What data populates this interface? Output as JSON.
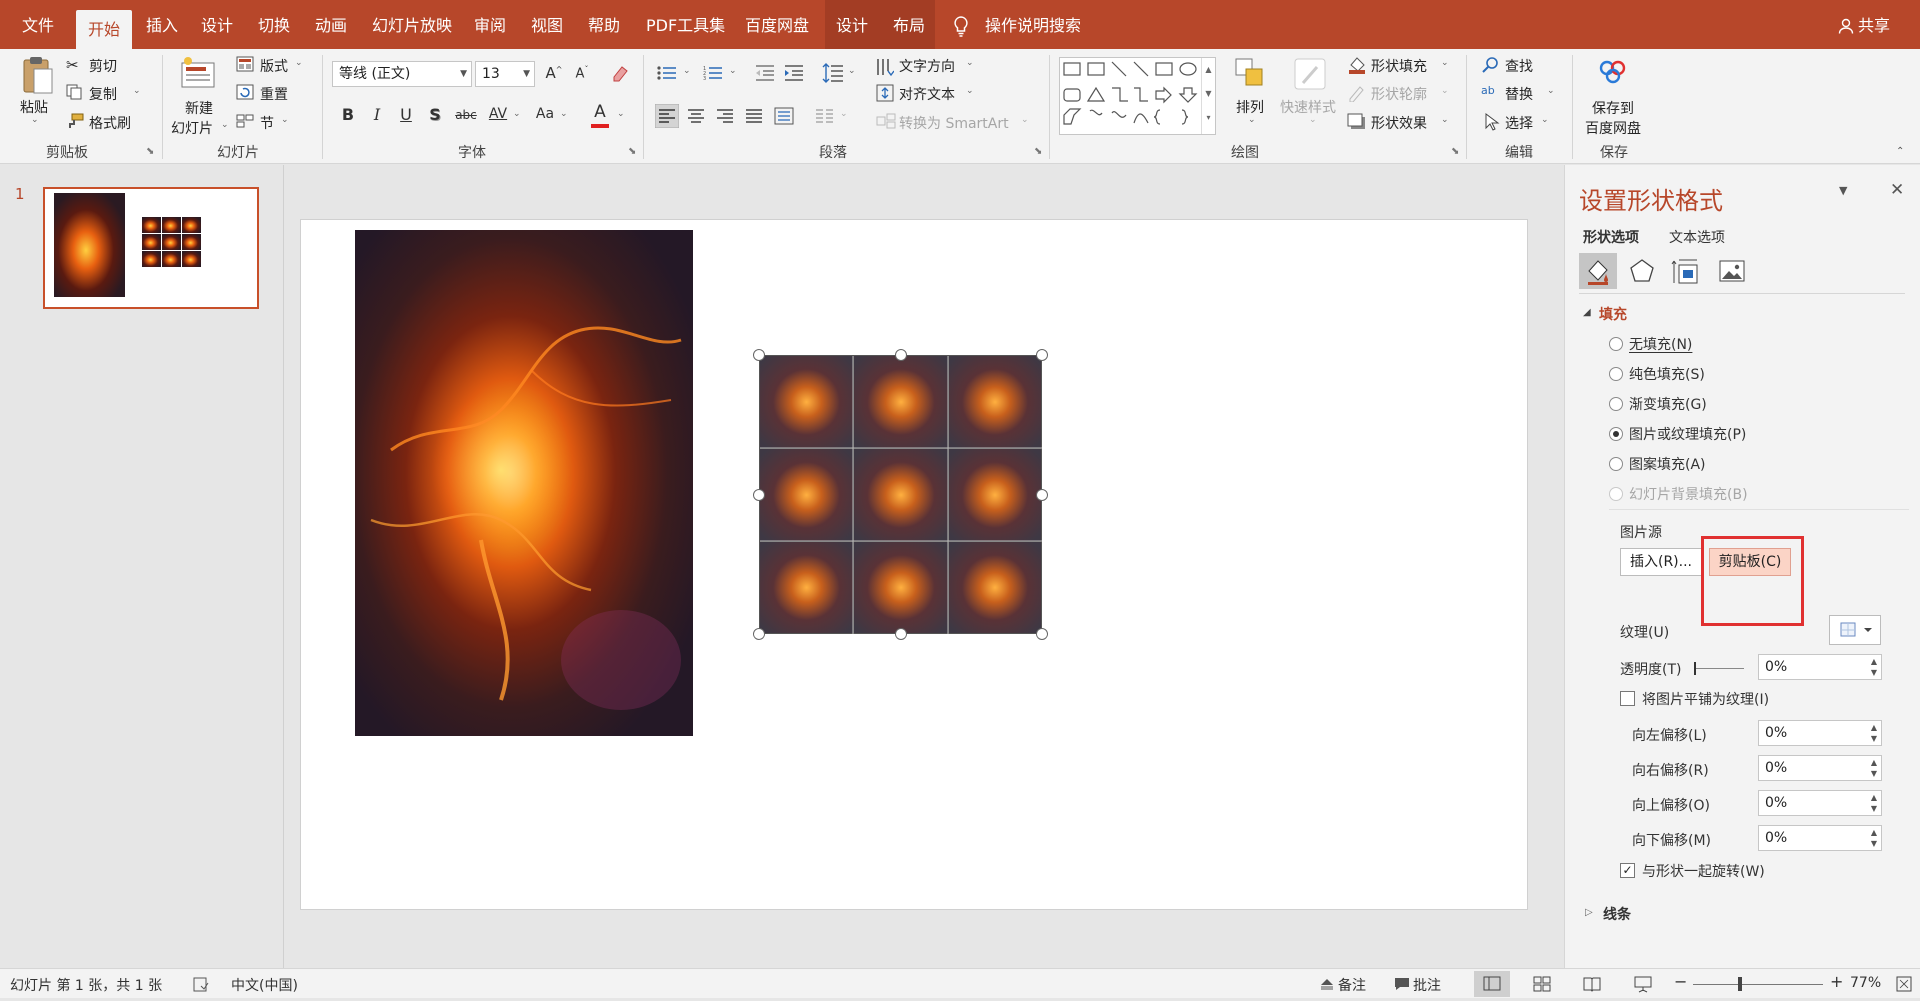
{
  "tabs": {
    "file": "文件",
    "home": "开始",
    "insert": "插入",
    "design": "设计",
    "transitions": "切换",
    "animations": "动画",
    "slideshow": "幻灯片放映",
    "review": "审阅",
    "view": "视图",
    "help": "帮助",
    "pdf": "PDF工具集",
    "baidu": "百度网盘",
    "ctx_design": "设计",
    "ctx_layout": "布局",
    "tellme": "操作说明搜索",
    "share": "共享"
  },
  "clipboard": {
    "paste": "粘贴",
    "cut": "剪切",
    "copy": "复制",
    "format_painter": "格式刷",
    "group": "剪贴板"
  },
  "slides": {
    "new_slide_1": "新建",
    "new_slide_2": "幻灯片",
    "layout": "版式",
    "reset": "重置",
    "section": "节",
    "group": "幻灯片"
  },
  "font": {
    "name": "等线 (正文)",
    "size": "13",
    "bold": "B",
    "italic": "I",
    "underline": "U",
    "shadow": "S",
    "strike": "abc",
    "spacing": "AV",
    "case": "Aa",
    "color_a": "A",
    "grow": "A",
    "shrink": "A",
    "group": "字体"
  },
  "paragraph": {
    "text_direction": "文字方向",
    "align_text": "对齐文本",
    "smartart": "转换为 SmartArt",
    "group": "段落"
  },
  "drawing": {
    "arrange": "排列",
    "quick_styles": "快速样式",
    "shape_fill": "形状填充",
    "shape_outline": "形状轮廓",
    "shape_effects": "形状效果",
    "group": "绘图"
  },
  "editing": {
    "find": "查找",
    "replace": "替换",
    "select": "选择",
    "group": "编辑"
  },
  "save": {
    "save_to_1": "保存到",
    "save_to_2": "百度网盘",
    "group": "保存"
  },
  "thumb": {
    "number": "1"
  },
  "panel": {
    "title": "设置形状格式",
    "tab_shape": "形状选项",
    "tab_text": "文本选项",
    "section_fill": "填充",
    "fill_options": [
      {
        "label": "无填充(N)",
        "selected": false,
        "disabled": false
      },
      {
        "label": "纯色填充(S)",
        "selected": false,
        "disabled": false
      },
      {
        "label": "渐变填充(G)",
        "selected": false,
        "disabled": false
      },
      {
        "label": "图片或纹理填充(P)",
        "selected": true,
        "disabled": false
      },
      {
        "label": "图案填充(A)",
        "selected": false,
        "disabled": false
      },
      {
        "label": "幻灯片背景填充(B)",
        "selected": false,
        "disabled": true
      }
    ],
    "picture_source": "图片源",
    "insert_btn": "插入(R)...",
    "clipboard_btn": "剪贴板(C)",
    "texture": "纹理(U)",
    "transparency": "透明度(T)",
    "transparency_value": "0%",
    "tile_label": "将图片平铺为纹理(I)",
    "tile_checked": false,
    "offset_left": "向左偏移(L)",
    "offset_left_value": "0%",
    "offset_right": "向右偏移(R)",
    "offset_right_value": "0%",
    "offset_top": "向上偏移(O)",
    "offset_top_value": "0%",
    "offset_bottom": "向下偏移(M)",
    "offset_bottom_value": "0%",
    "rotate_label": "与形状一起旋转(W)",
    "rotate_checked": true,
    "section_line": "线条"
  },
  "status": {
    "slide_info": "幻灯片 第 1 张，共 1 张",
    "language": "中文(中国)",
    "notes": "备注",
    "comments": "批注",
    "zoom": "77%"
  },
  "colors": {
    "accent": "#b7472a",
    "highlight": "#e03030"
  }
}
